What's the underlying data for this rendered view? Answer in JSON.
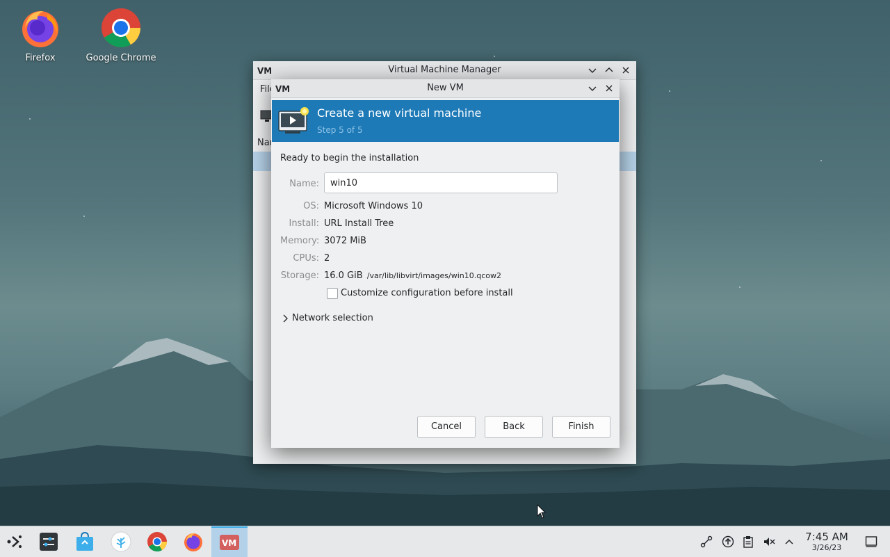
{
  "desktop": {
    "icons": [
      {
        "label": "Firefox",
        "icon": "firefox-icon"
      },
      {
        "label": "Google Chrome",
        "icon": "chrome-icon"
      }
    ]
  },
  "vmm_window": {
    "title": "Virtual Machine Manager",
    "menu_partial": "File",
    "header_partial": "Nam"
  },
  "new_vm": {
    "title": "New VM",
    "banner_title": "Create a new virtual machine",
    "banner_step": "Step 5 of 5",
    "ready_text": "Ready to begin the installation",
    "name_label": "Name:",
    "name_value": "win10",
    "os_label": "OS:",
    "os_value": "Microsoft Windows 10",
    "install_label": "Install:",
    "install_value": "URL Install Tree",
    "memory_label": "Memory:",
    "memory_value": "3072 MiB",
    "cpus_label": "CPUs:",
    "cpus_value": "2",
    "storage_label": "Storage:",
    "storage_size": "16.0 GiB",
    "storage_path": "/var/lib/libvirt/images/win10.qcow2",
    "customize_label": "Customize configuration before install",
    "customize_checked": false,
    "network_label": "Network selection",
    "cancel_label": "Cancel",
    "back_label": "Back",
    "finish_label": "Finish"
  },
  "taskbar": {
    "items": [
      "application-launcher-icon",
      "system-settings-icon",
      "discover-store-icon",
      "plasma-icon",
      "chrome-icon",
      "firefox-icon",
      "virt-manager-icon"
    ],
    "active_item": "virt-manager-icon",
    "tray": [
      "network-icon",
      "updates-icon",
      "clipboard-icon",
      "volume-muted-icon",
      "expand-tray-icon"
    ],
    "time": "7:45 AM",
    "date": "3/26/23"
  },
  "colors": {
    "banner": "#1d7ab7",
    "selection": "#b7d3ea",
    "accent": "#3daee9"
  }
}
